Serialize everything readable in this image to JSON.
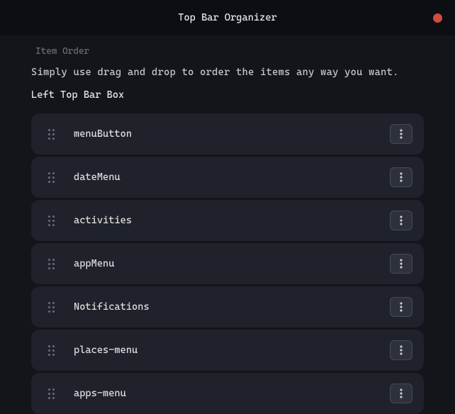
{
  "titlebar": {
    "title": "Top Bar Organizer"
  },
  "section": {
    "heading": "Item Order",
    "description": "Simply use drag and drop to order the items any way you want.",
    "subsection_heading": "Left Top Bar Box"
  },
  "items": [
    {
      "label": "menuButton"
    },
    {
      "label": "dateMenu"
    },
    {
      "label": "activities"
    },
    {
      "label": "appMenu"
    },
    {
      "label": "Notifications"
    },
    {
      "label": "places-menu"
    },
    {
      "label": "apps-menu"
    }
  ]
}
